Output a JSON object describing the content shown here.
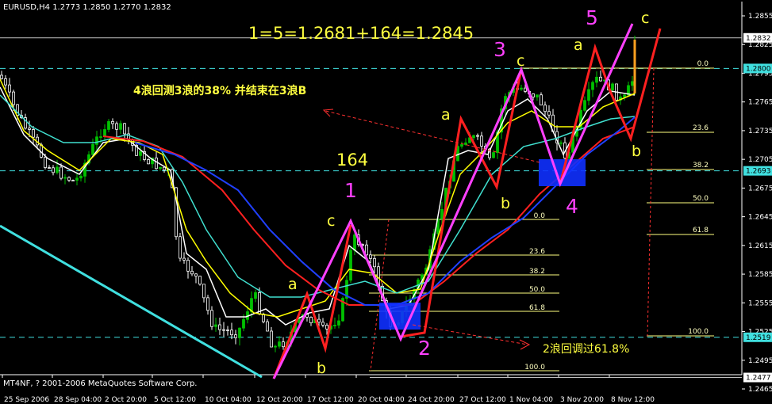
{
  "header": "EURUSD,H4  1.2773 1.2850 1.2770 1.2832",
  "copyright": "MT4NF, ? 2001-2006 MetaQuotes Software Corp.",
  "colors": {
    "background": "#000000",
    "bull_candle": "#00c000",
    "bear_candle": "#ffffff",
    "ma_fast": "#ffffff",
    "ma_2": "#ffff00",
    "ma_3": "#40e0d0",
    "ma_4": "#ff2020",
    "ma_5": "#2040ff",
    "wave_magenta": "#ff40ff",
    "wave_red": "#ff2020",
    "fib_line": "#ffff80",
    "cyan_level": "#40e0e0",
    "trendline": "#40e0e0",
    "annotation_yellow": "#ffff40"
  },
  "annotations": {
    "formula": "1=5=1.2681+164=1.2845",
    "wave4_note": "4浪回测3浪的38% 并结束在3浪B",
    "wave2_note": "2浪回调过61.8%",
    "pips_164": "164",
    "wave_1": "1",
    "wave_2": "2",
    "wave_3": "3",
    "wave_4": "4",
    "wave_5": "5",
    "a1": "a",
    "b1": "b",
    "c1": "c",
    "a2": "a",
    "b2": "b",
    "c2": "c",
    "a3": "a",
    "b3": "b",
    "c3": "c"
  },
  "fib_left": {
    "labels": [
      "0.0",
      "23.6",
      "38.2",
      "50.0",
      "61.8",
      "100.0"
    ]
  },
  "fib_right": {
    "labels": [
      "0.0",
      "23.6",
      "38.2",
      "50.0",
      "61.8",
      "100.0"
    ]
  },
  "chart_data": {
    "type": "candlestick",
    "symbol": "EURUSD",
    "timeframe": "H4",
    "ohlc_current": {
      "open": 1.2773,
      "high": 1.285,
      "low": 1.277,
      "close": 1.2832
    },
    "ylim": [
      1.2455,
      1.287
    ],
    "price_ticks": [
      1.2855,
      1.2825,
      1.2795,
      1.2765,
      1.2735,
      1.2705,
      1.2675,
      1.2645,
      1.2615,
      1.2585,
      1.2555,
      1.2525,
      1.2495,
      1.2465
    ],
    "highlighted_prices": [
      1.2832,
      1.28,
      1.2693,
      1.2519,
      1.2477
    ],
    "time_ticks": [
      "25 Sep 2006",
      "28 Sep 04:00",
      "2 Oct 20:00",
      "5 Oct 12:00",
      "10 Oct 04:00",
      "12 Oct 20:00",
      "17 Oct 12:00",
      "20 Oct 04:00",
      "24 Oct 20:00",
      "27 Oct 12:00",
      "1 Nov 04:00",
      "3 Nov 20:00",
      "8 Nov 12:00"
    ],
    "waves": [
      {
        "label": "1",
        "price": 1.2641
      },
      {
        "label": "2",
        "price": 1.2519
      },
      {
        "label": "3",
        "price": 1.28
      },
      {
        "label": "4",
        "price": 1.2681
      },
      {
        "label": "5",
        "price": 1.2845
      }
    ]
  }
}
